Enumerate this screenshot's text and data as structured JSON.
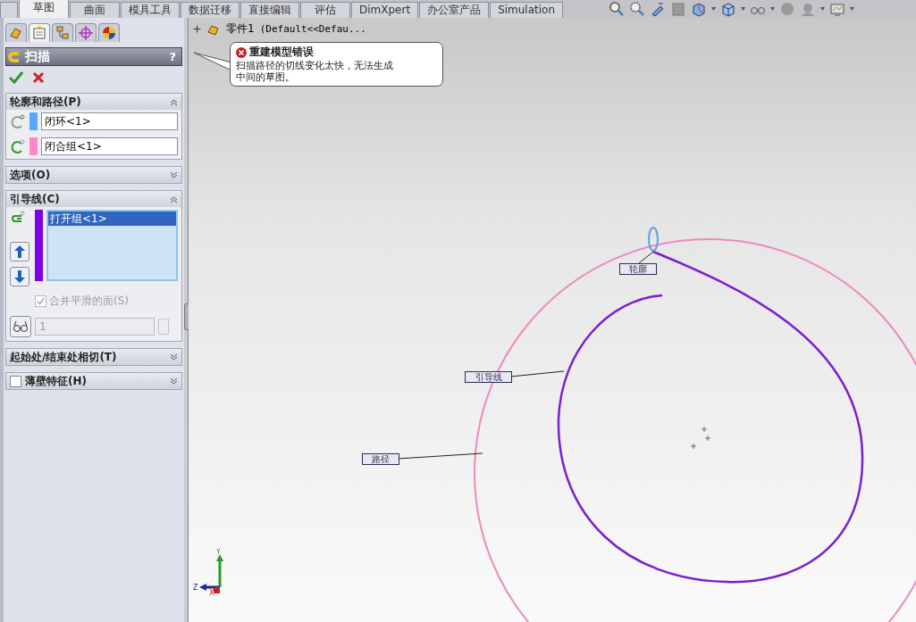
{
  "tabs": [
    {
      "selected": false
    },
    {
      "label": "草图",
      "selected": true
    },
    {
      "label": "曲面",
      "selected": false
    },
    {
      "label": "模具工具",
      "selected": false
    },
    {
      "label": "数据迁移",
      "selected": false
    },
    {
      "label": "直接编辑",
      "selected": false
    },
    {
      "label": "评估",
      "selected": false
    },
    {
      "label": "DimXpert",
      "selected": false
    },
    {
      "label": "办公室产品",
      "selected": false
    },
    {
      "label": "Simulation",
      "selected": false
    }
  ],
  "panel_tabs": [
    {
      "kind": "features",
      "selected": false
    },
    {
      "kind": "properties",
      "selected": true
    },
    {
      "kind": "configurations",
      "selected": false
    },
    {
      "kind": "target",
      "selected": false
    },
    {
      "kind": "appearance",
      "selected": false
    }
  ],
  "property_manager": {
    "title": "扫描",
    "help": "?",
    "sections": [
      {
        "kind": "profile_path",
        "title": "轮廓和路径(P)",
        "expanded": true,
        "fields": [
          {
            "value": "闭环<1>",
            "color": "#55aaff"
          },
          {
            "value": "闭合组<1>",
            "color": "#ff88c8"
          }
        ]
      },
      {
        "kind": "plain",
        "title": "选项(O)",
        "expanded": false
      },
      {
        "kind": "guides",
        "title": "引导线(C)",
        "expanded": true,
        "color": "#7a00e6",
        "items": [
          {
            "text": "打开组<1>",
            "selected": true
          }
        ],
        "merge": {
          "label": "合并平滑的面(S)",
          "checked": true,
          "disabled": true
        },
        "spin": {
          "value": "1"
        }
      },
      {
        "kind": "plain",
        "title": "起始处/结束处相切(T)",
        "expanded": false
      },
      {
        "kind": "checkbox",
        "title": "薄壁特征(H)",
        "expanded": false,
        "checked": false
      }
    ]
  },
  "tree": {
    "part": "零件1",
    "config": "(Default<<Defau..."
  },
  "error_balloon": {
    "title": "重建模型错误",
    "message_lines": [
      "扫描路径的切线变化太快，无法生成",
      "中间的草图。"
    ]
  },
  "canvas_labels": [
    {
      "kind": "profile",
      "text": "轮廓"
    },
    {
      "kind": "guide",
      "text": "引导线"
    },
    {
      "kind": "path",
      "text": "路径"
    }
  ],
  "triad": {
    "y": "Y",
    "z": "Z",
    "x": "X"
  }
}
